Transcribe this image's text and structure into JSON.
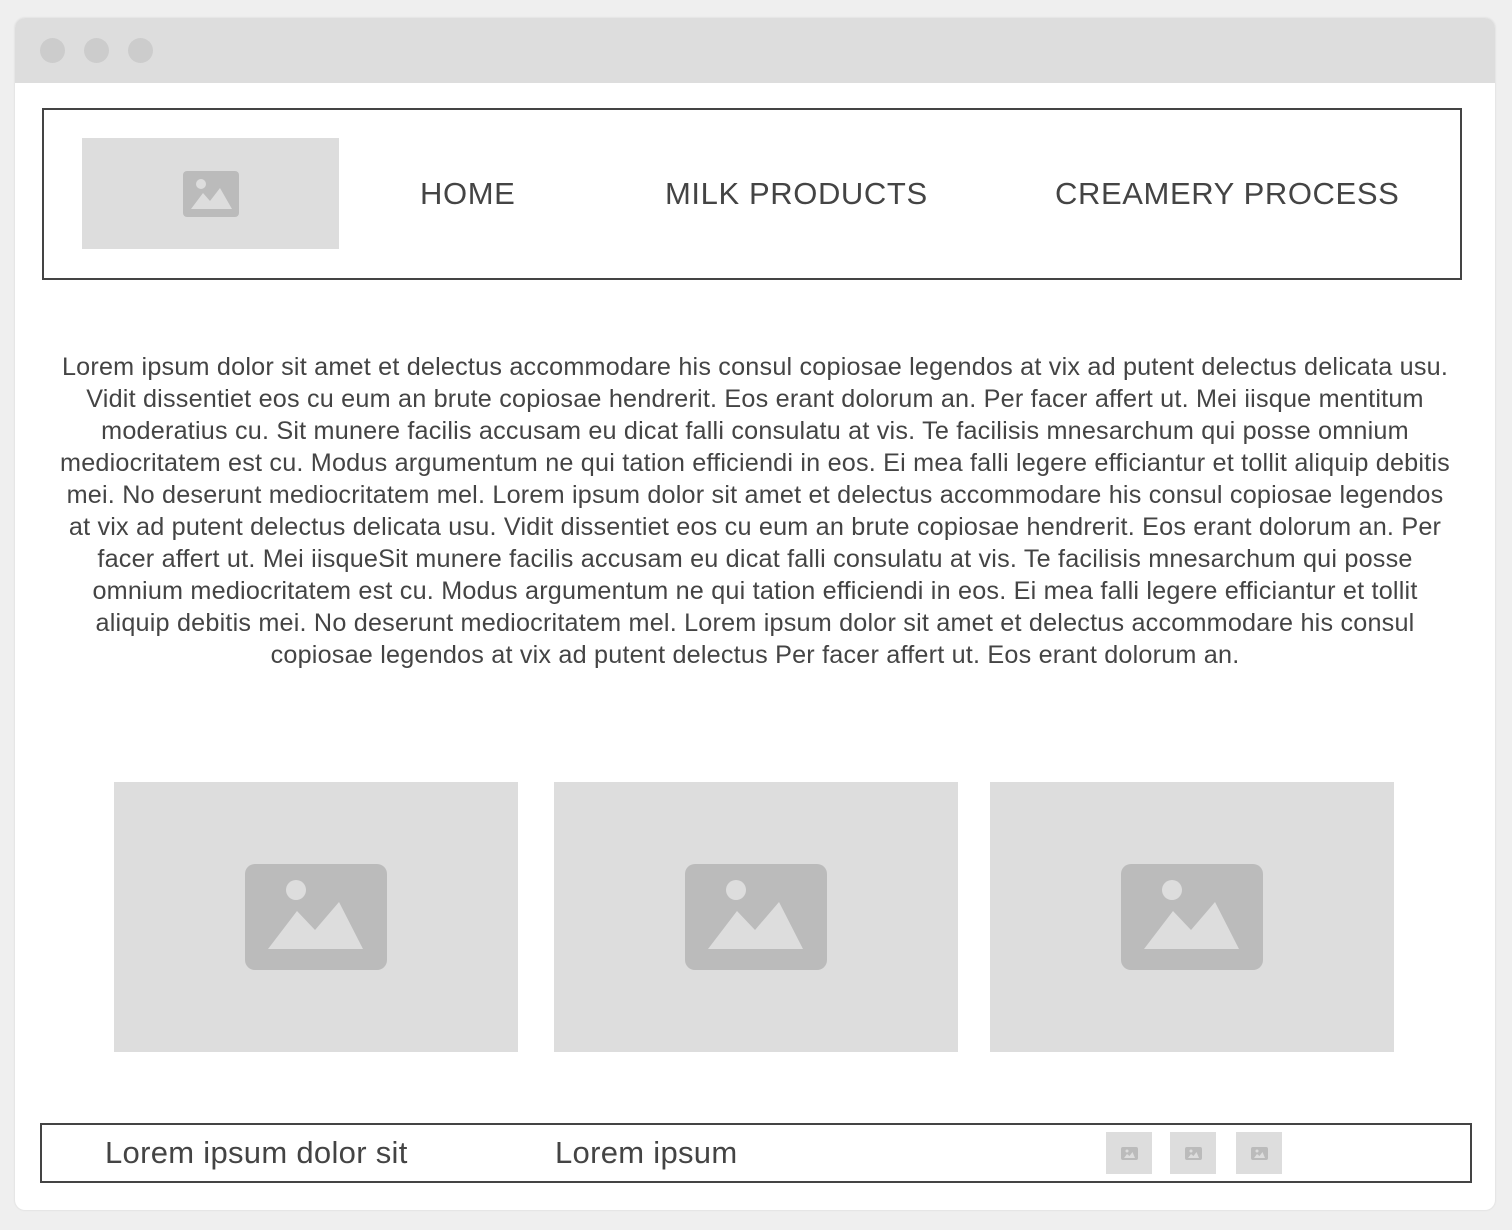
{
  "header": {
    "logo_icon": "image-placeholder-icon",
    "nav": [
      {
        "label": "HOME"
      },
      {
        "label": "MILK PRODUCTS"
      },
      {
        "label": "CREAMERY PROCESS"
      }
    ]
  },
  "main": {
    "body_text": "Lorem ipsum dolor sit amet et delectus accommodare his consul copiosae legendos at vix ad putent delectus delicata usu. Vidit dissentiet eos cu eum an brute copiosae hendrerit. Eos erant dolorum an. Per facer affert ut. Mei iisque mentitum moderatius cu. Sit munere facilis accusam eu dicat falli consulatu at vis. Te facilisis mnesarchum qui posse omnium mediocritatem est cu. Modus argumentum ne qui tation efficiendi in eos. Ei mea falli legere efficiantur et tollit aliquip debitis mei. No deserunt mediocritatem mel. Lorem ipsum dolor sit amet et delectus accommodare his consul copiosae legendos at vix ad putent delectus delicata usu. Vidit dissentiet eos cu eum an brute copiosae hendrerit. Eos erant dolorum an. Per facer affert ut. Mei iisqueSit munere facilis accusam eu dicat falli consulatu at vis. Te facilisis mnesarchum qui posse omnium mediocritatem est cu. Modus argumentum ne qui tation efficiendi in eos. Ei mea falli legere efficiantur et tollit aliquip debitis mei. No deserunt mediocritatem mel. Lorem ipsum dolor sit amet et delectus accommodare his consul copiosae legendos at vix ad putent delectus Per facer affert ut. Eos erant dolorum an.",
    "gallery_icon": "image-placeholder-icon"
  },
  "footer": {
    "text_1": "Lorem ipsum dolor sit",
    "text_2": "Lorem ipsum",
    "icon": "image-placeholder-icon"
  },
  "colors": {
    "placeholder_bg": "#dddddd",
    "placeholder_icon": "#bbbbbb",
    "text": "#444444",
    "border": "#444444"
  }
}
